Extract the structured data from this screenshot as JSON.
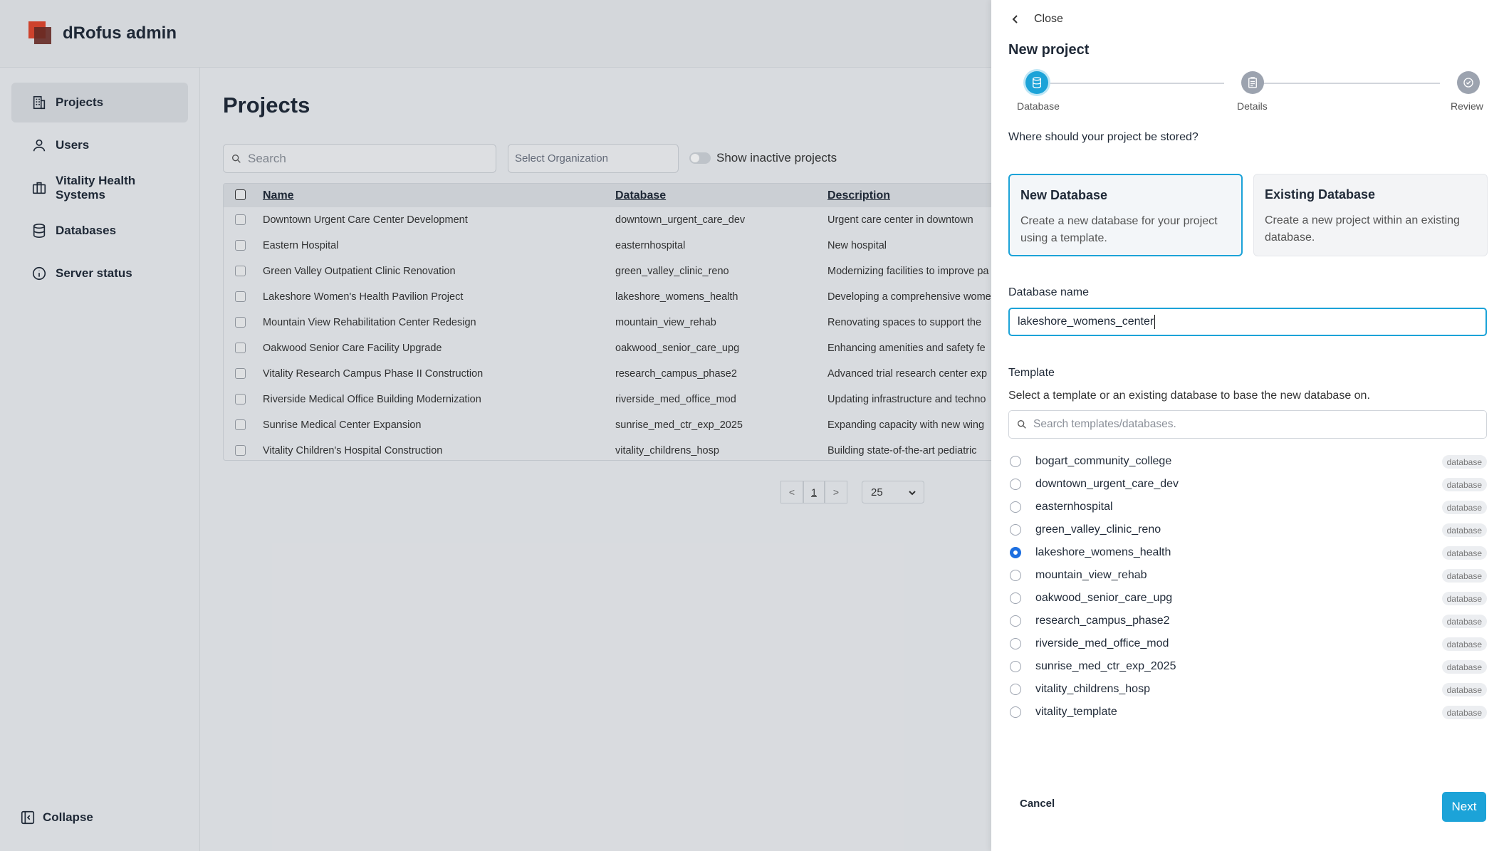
{
  "app": {
    "title": "dRofus admin",
    "colors": {
      "accent": "#1ca3d8",
      "radio_selected": "#1d6fe0",
      "logo_primary": "#e2462c",
      "logo_secondary": "#6e2a22"
    }
  },
  "sidebar": {
    "items": [
      {
        "label": "Projects",
        "icon": "building-icon",
        "active": true
      },
      {
        "label": "Users",
        "icon": "user-icon",
        "active": false
      },
      {
        "label": "Vitality Health Systems",
        "icon": "briefcase-icon",
        "active": false
      },
      {
        "label": "Databases",
        "icon": "database-icon",
        "active": false
      },
      {
        "label": "Server status",
        "icon": "info-icon",
        "active": false
      }
    ],
    "collapse_label": "Collapse"
  },
  "projects": {
    "title": "Projects",
    "search_placeholder": "Search",
    "org_placeholder": "Select Organization",
    "inactive_toggle_label": "Show inactive projects",
    "columns": {
      "name": "Name",
      "database": "Database",
      "description": "Description"
    },
    "rows": [
      {
        "name": "Downtown Urgent Care Center Development",
        "database": "downtown_urgent_care_dev",
        "description": "Urgent care center in downtown"
      },
      {
        "name": "Eastern Hospital",
        "database": "easternhospital",
        "description": "New hospital"
      },
      {
        "name": "Green Valley Outpatient Clinic Renovation",
        "database": "green_valley_clinic_reno",
        "description": "Modernizing facilities to improve pa"
      },
      {
        "name": "Lakeshore Women's Health Pavilion Project",
        "database": "lakeshore_womens_health",
        "description": "Developing a comprehensive wome"
      },
      {
        "name": "Mountain View Rehabilitation Center Redesign",
        "database": "mountain_view_rehab",
        "description": "Renovating spaces to support the"
      },
      {
        "name": "Oakwood Senior Care Facility Upgrade",
        "database": "oakwood_senior_care_upg",
        "description": "Enhancing amenities and safety fe"
      },
      {
        "name": "Vitality Research Campus Phase II Construction",
        "database": "research_campus_phase2",
        "description": "Advanced trial research center exp"
      },
      {
        "name": "Riverside Medical Office Building Modernization",
        "database": "riverside_med_office_mod",
        "description": "Updating infrastructure and techno"
      },
      {
        "name": "Sunrise Medical Center Expansion",
        "database": "sunrise_med_ctr_exp_2025",
        "description": "Expanding capacity with new wing"
      },
      {
        "name": "Vitality Children's Hospital Construction",
        "database": "vitality_childrens_hosp",
        "description": "Building state-of-the-art pediatric"
      }
    ],
    "pagination": {
      "prev": "<",
      "page": "1",
      "next": ">",
      "page_size": "25"
    }
  },
  "drawer": {
    "close_label": "Close",
    "title": "New project",
    "steps": [
      {
        "label": "Database",
        "icon": "database-icon",
        "state": "active"
      },
      {
        "label": "Details",
        "icon": "clipboard-icon",
        "state": "todo"
      },
      {
        "label": "Review",
        "icon": "check-circle-icon",
        "state": "todo"
      }
    ],
    "question": "Where should your project be stored?",
    "options": {
      "new": {
        "title": "New Database",
        "desc": "Create a new database for your project using a template.",
        "selected": true
      },
      "existing": {
        "title": "Existing Database",
        "desc": "Create a new project within an existing database.",
        "selected": false
      }
    },
    "db_name_label": "Database name",
    "db_name_value": "lakeshore_womens_center",
    "template_label": "Template",
    "template_help": "Select a template or an existing database to base the new database on.",
    "template_search_placeholder": "Search templates/databases.",
    "templates": [
      {
        "name": "bogart_community_college",
        "badge": "database",
        "selected": false
      },
      {
        "name": "downtown_urgent_care_dev",
        "badge": "database",
        "selected": false
      },
      {
        "name": "easternhospital",
        "badge": "database",
        "selected": false
      },
      {
        "name": "green_valley_clinic_reno",
        "badge": "database",
        "selected": false
      },
      {
        "name": "lakeshore_womens_health",
        "badge": "database",
        "selected": true
      },
      {
        "name": "mountain_view_rehab",
        "badge": "database",
        "selected": false
      },
      {
        "name": "oakwood_senior_care_upg",
        "badge": "database",
        "selected": false
      },
      {
        "name": "research_campus_phase2",
        "badge": "database",
        "selected": false
      },
      {
        "name": "riverside_med_office_mod",
        "badge": "database",
        "selected": false
      },
      {
        "name": "sunrise_med_ctr_exp_2025",
        "badge": "database",
        "selected": false
      },
      {
        "name": "vitality_childrens_hosp",
        "badge": "database",
        "selected": false
      },
      {
        "name": "vitality_template",
        "badge": "database",
        "selected": false
      }
    ],
    "cancel_label": "Cancel",
    "next_label": "Next"
  }
}
